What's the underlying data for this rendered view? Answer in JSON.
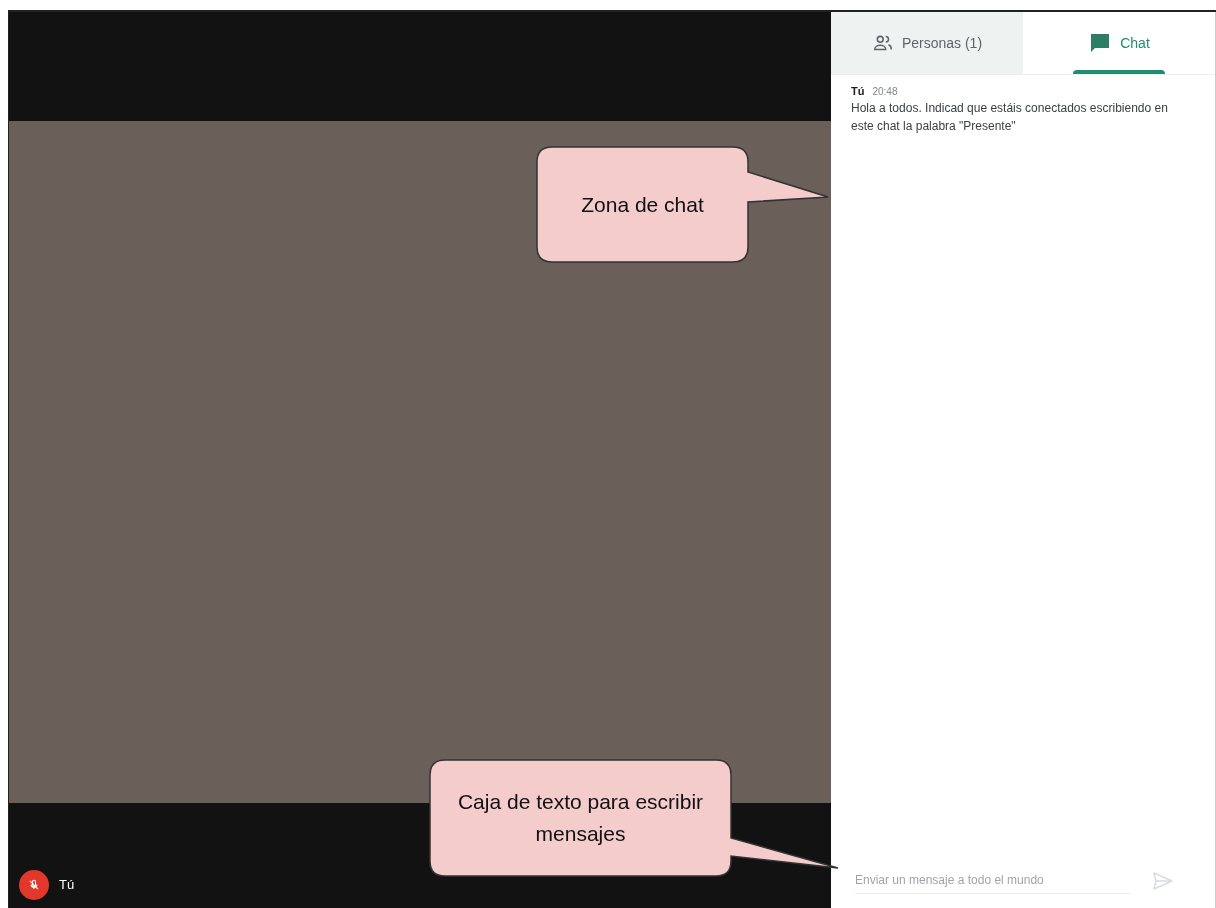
{
  "tabs": [
    {
      "kind": "people",
      "label": "Personas (1)",
      "selected": false
    },
    {
      "kind": "chat",
      "label": "Chat",
      "selected": true
    }
  ],
  "messages": [
    {
      "sender": "Tú",
      "time": "20:48",
      "text": "Hola a todos. Indicad que estáis conectados escribiendo en este chat la palabra \"Presente\""
    }
  ],
  "message_input": {
    "placeholder": "Enviar un mensaje a todo el mundo"
  },
  "participant": {
    "name": "Tú",
    "muted": true
  },
  "callouts": [
    {
      "text": "Zona de chat"
    },
    {
      "text": "Caja de texto para escribir mensajes"
    }
  ]
}
